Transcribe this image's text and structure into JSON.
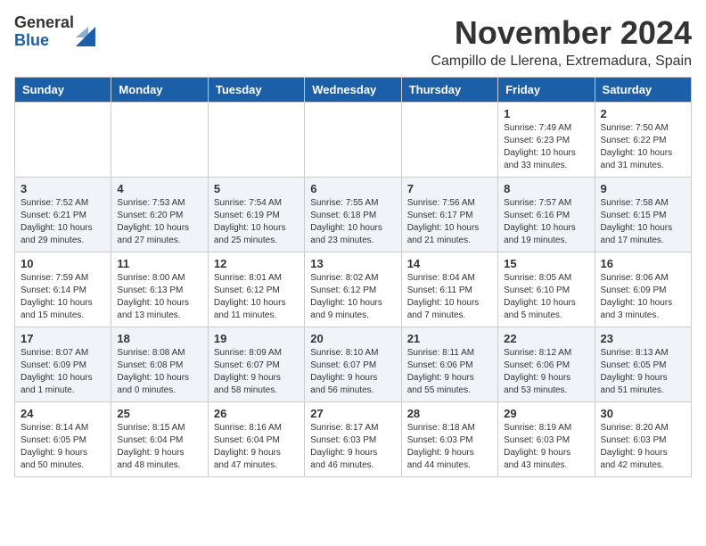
{
  "header": {
    "logo_general": "General",
    "logo_blue": "Blue",
    "month_title": "November 2024",
    "location": "Campillo de Llerena, Extremadura, Spain"
  },
  "weekdays": [
    "Sunday",
    "Monday",
    "Tuesday",
    "Wednesday",
    "Thursday",
    "Friday",
    "Saturday"
  ],
  "weeks": [
    [
      {
        "day": "",
        "info": ""
      },
      {
        "day": "",
        "info": ""
      },
      {
        "day": "",
        "info": ""
      },
      {
        "day": "",
        "info": ""
      },
      {
        "day": "",
        "info": ""
      },
      {
        "day": "1",
        "info": "Sunrise: 7:49 AM\nSunset: 6:23 PM\nDaylight: 10 hours\nand 33 minutes."
      },
      {
        "day": "2",
        "info": "Sunrise: 7:50 AM\nSunset: 6:22 PM\nDaylight: 10 hours\nand 31 minutes."
      }
    ],
    [
      {
        "day": "3",
        "info": "Sunrise: 7:52 AM\nSunset: 6:21 PM\nDaylight: 10 hours\nand 29 minutes."
      },
      {
        "day": "4",
        "info": "Sunrise: 7:53 AM\nSunset: 6:20 PM\nDaylight: 10 hours\nand 27 minutes."
      },
      {
        "day": "5",
        "info": "Sunrise: 7:54 AM\nSunset: 6:19 PM\nDaylight: 10 hours\nand 25 minutes."
      },
      {
        "day": "6",
        "info": "Sunrise: 7:55 AM\nSunset: 6:18 PM\nDaylight: 10 hours\nand 23 minutes."
      },
      {
        "day": "7",
        "info": "Sunrise: 7:56 AM\nSunset: 6:17 PM\nDaylight: 10 hours\nand 21 minutes."
      },
      {
        "day": "8",
        "info": "Sunrise: 7:57 AM\nSunset: 6:16 PM\nDaylight: 10 hours\nand 19 minutes."
      },
      {
        "day": "9",
        "info": "Sunrise: 7:58 AM\nSunset: 6:15 PM\nDaylight: 10 hours\nand 17 minutes."
      }
    ],
    [
      {
        "day": "10",
        "info": "Sunrise: 7:59 AM\nSunset: 6:14 PM\nDaylight: 10 hours\nand 15 minutes."
      },
      {
        "day": "11",
        "info": "Sunrise: 8:00 AM\nSunset: 6:13 PM\nDaylight: 10 hours\nand 13 minutes."
      },
      {
        "day": "12",
        "info": "Sunrise: 8:01 AM\nSunset: 6:12 PM\nDaylight: 10 hours\nand 11 minutes."
      },
      {
        "day": "13",
        "info": "Sunrise: 8:02 AM\nSunset: 6:12 PM\nDaylight: 10 hours\nand 9 minutes."
      },
      {
        "day": "14",
        "info": "Sunrise: 8:04 AM\nSunset: 6:11 PM\nDaylight: 10 hours\nand 7 minutes."
      },
      {
        "day": "15",
        "info": "Sunrise: 8:05 AM\nSunset: 6:10 PM\nDaylight: 10 hours\nand 5 minutes."
      },
      {
        "day": "16",
        "info": "Sunrise: 8:06 AM\nSunset: 6:09 PM\nDaylight: 10 hours\nand 3 minutes."
      }
    ],
    [
      {
        "day": "17",
        "info": "Sunrise: 8:07 AM\nSunset: 6:09 PM\nDaylight: 10 hours\nand 1 minute."
      },
      {
        "day": "18",
        "info": "Sunrise: 8:08 AM\nSunset: 6:08 PM\nDaylight: 10 hours\nand 0 minutes."
      },
      {
        "day": "19",
        "info": "Sunrise: 8:09 AM\nSunset: 6:07 PM\nDaylight: 9 hours\nand 58 minutes."
      },
      {
        "day": "20",
        "info": "Sunrise: 8:10 AM\nSunset: 6:07 PM\nDaylight: 9 hours\nand 56 minutes."
      },
      {
        "day": "21",
        "info": "Sunrise: 8:11 AM\nSunset: 6:06 PM\nDaylight: 9 hours\nand 55 minutes."
      },
      {
        "day": "22",
        "info": "Sunrise: 8:12 AM\nSunset: 6:06 PM\nDaylight: 9 hours\nand 53 minutes."
      },
      {
        "day": "23",
        "info": "Sunrise: 8:13 AM\nSunset: 6:05 PM\nDaylight: 9 hours\nand 51 minutes."
      }
    ],
    [
      {
        "day": "24",
        "info": "Sunrise: 8:14 AM\nSunset: 6:05 PM\nDaylight: 9 hours\nand 50 minutes."
      },
      {
        "day": "25",
        "info": "Sunrise: 8:15 AM\nSunset: 6:04 PM\nDaylight: 9 hours\nand 48 minutes."
      },
      {
        "day": "26",
        "info": "Sunrise: 8:16 AM\nSunset: 6:04 PM\nDaylight: 9 hours\nand 47 minutes."
      },
      {
        "day": "27",
        "info": "Sunrise: 8:17 AM\nSunset: 6:03 PM\nDaylight: 9 hours\nand 46 minutes."
      },
      {
        "day": "28",
        "info": "Sunrise: 8:18 AM\nSunset: 6:03 PM\nDaylight: 9 hours\nand 44 minutes."
      },
      {
        "day": "29",
        "info": "Sunrise: 8:19 AM\nSunset: 6:03 PM\nDaylight: 9 hours\nand 43 minutes."
      },
      {
        "day": "30",
        "info": "Sunrise: 8:20 AM\nSunset: 6:03 PM\nDaylight: 9 hours\nand 42 minutes."
      }
    ]
  ]
}
